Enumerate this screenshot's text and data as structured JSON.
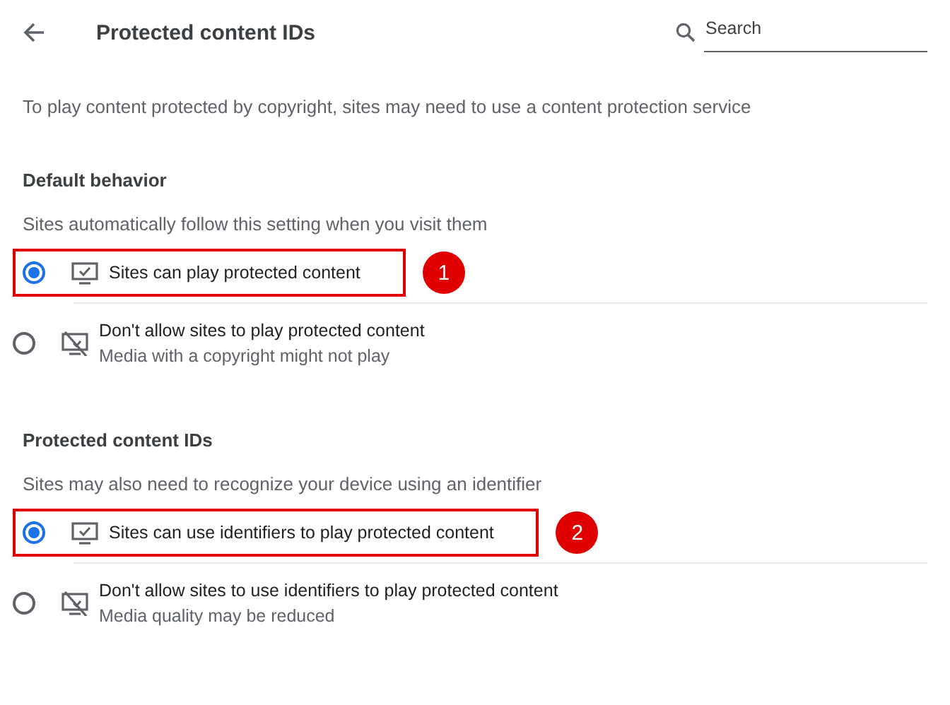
{
  "header": {
    "title": "Protected content IDs",
    "search": {
      "placeholder": "Search"
    }
  },
  "description": "To play content protected by copyright, sites may need to use a content protection service",
  "sections": [
    {
      "heading": "Default behavior",
      "subtext": "Sites automatically follow this setting when you visit them",
      "options": [
        {
          "label": "Sites can play protected content",
          "selected": true,
          "kind": "allow",
          "callout": "1"
        },
        {
          "label": "Don't allow sites to play protected content",
          "sublabel": "Media with a copyright might not play",
          "selected": false,
          "kind": "block"
        }
      ]
    },
    {
      "heading": "Protected content IDs",
      "subtext": "Sites may also need to recognize your device using an identifier",
      "options": [
        {
          "label": "Sites can use identifiers to play protected content",
          "selected": true,
          "kind": "allow",
          "callout": "2"
        },
        {
          "label": "Don't allow sites to use identifiers to play protected content",
          "sublabel": "Media quality may be reduced",
          "selected": false,
          "kind": "block"
        }
      ]
    }
  ]
}
